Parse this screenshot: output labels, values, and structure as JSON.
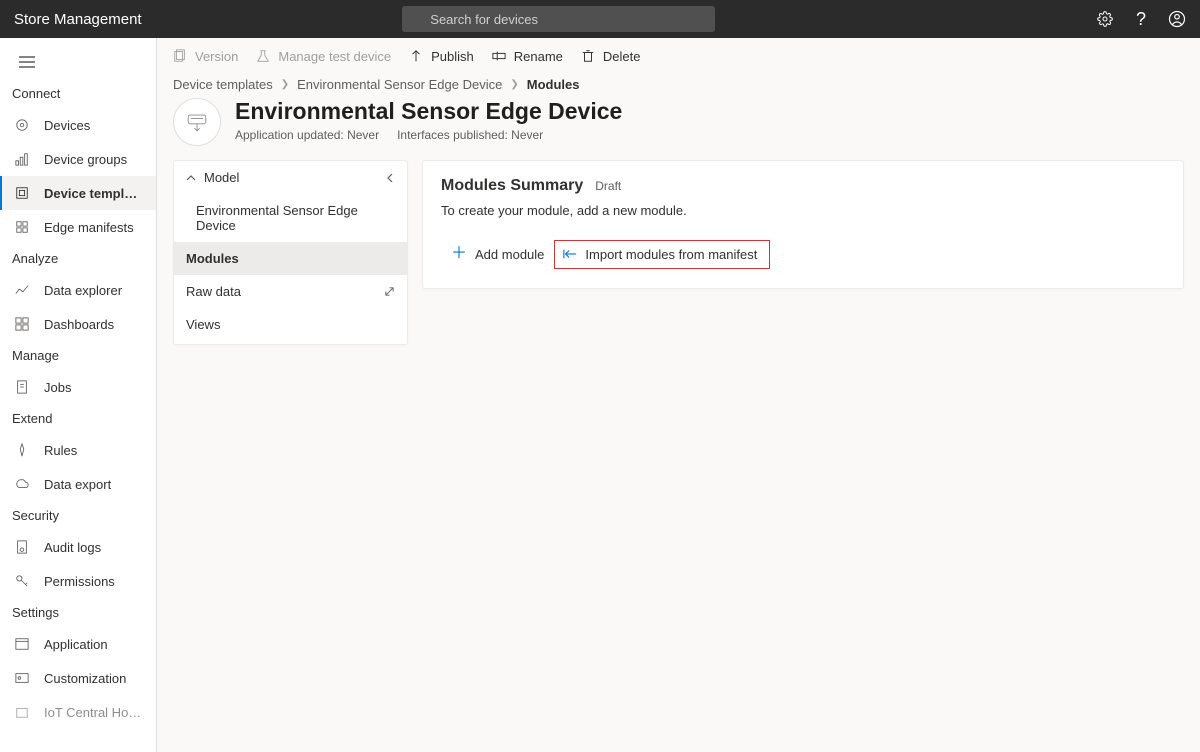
{
  "app": {
    "title": "Store Management"
  },
  "search": {
    "placeholder": "Search for devices"
  },
  "sidebar": {
    "groups": [
      {
        "title": "Connect",
        "items": [
          {
            "label": "Devices"
          },
          {
            "label": "Device groups"
          },
          {
            "label": "Device templates"
          },
          {
            "label": "Edge manifests"
          }
        ]
      },
      {
        "title": "Analyze",
        "items": [
          {
            "label": "Data explorer"
          },
          {
            "label": "Dashboards"
          }
        ]
      },
      {
        "title": "Manage",
        "items": [
          {
            "label": "Jobs"
          }
        ]
      },
      {
        "title": "Extend",
        "items": [
          {
            "label": "Rules"
          },
          {
            "label": "Data export"
          }
        ]
      },
      {
        "title": "Security",
        "items": [
          {
            "label": "Audit logs"
          },
          {
            "label": "Permissions"
          }
        ]
      },
      {
        "title": "Settings",
        "items": [
          {
            "label": "Application"
          },
          {
            "label": "Customization"
          },
          {
            "label": "IoT Central Home"
          }
        ]
      }
    ]
  },
  "toolbar": {
    "version": "Version",
    "manage_test": "Manage test device",
    "publish": "Publish",
    "rename": "Rename",
    "delete": "Delete"
  },
  "breadcrumb": {
    "root": "Device templates",
    "parent": "Environmental Sensor Edge Device",
    "current": "Modules"
  },
  "template": {
    "title": "Environmental Sensor Edge Device",
    "app_updated": "Application updated: Never",
    "interfaces_pub": "Interfaces published: Never"
  },
  "model_panel": {
    "header": "Model",
    "items": [
      {
        "label": "Environmental Sensor Edge Device"
      },
      {
        "label": "Modules"
      },
      {
        "label": "Raw data"
      },
      {
        "label": "Views"
      }
    ]
  },
  "summary": {
    "title": "Modules Summary",
    "badge": "Draft",
    "desc": "To create your module, add a new module.",
    "add": "Add module",
    "import": "Import modules from manifest"
  }
}
